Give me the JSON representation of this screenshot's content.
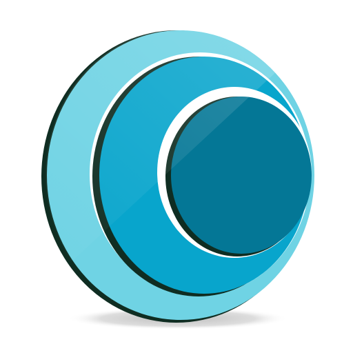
{
  "icon": {
    "name": "concentric-rings-icon",
    "colors": {
      "background": "#ffffff",
      "outer_ring": "#6fd3e4",
      "middle_ring": "#08a5cc",
      "inner_disc": "#047796",
      "edge_shadow": "#0f2d22",
      "gap_highlight": "#ffffff",
      "ground_shadow": "#c9c9c9"
    }
  }
}
